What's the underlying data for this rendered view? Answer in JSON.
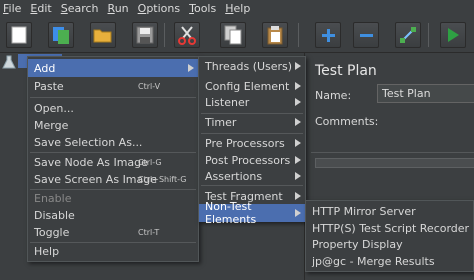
{
  "menubar": {
    "items": [
      {
        "label": "File"
      },
      {
        "label": "Edit"
      },
      {
        "label": "Search"
      },
      {
        "label": "Run"
      },
      {
        "label": "Options"
      },
      {
        "label": "Tools"
      },
      {
        "label": "Help"
      }
    ]
  },
  "toolbar": {
    "buttons": [
      {
        "icon": "new-file-icon"
      },
      {
        "icon": "templates-icon"
      },
      {
        "icon": "open-folder-icon"
      },
      {
        "icon": "save-icon"
      },
      {
        "icon": "cut-icon"
      },
      {
        "icon": "copy-icon"
      },
      {
        "icon": "paste-icon"
      },
      {
        "icon": "expand-plus-icon"
      },
      {
        "icon": "collapse-minus-icon"
      },
      {
        "icon": "toggle-icon"
      },
      {
        "icon": "run-icon"
      }
    ]
  },
  "tree": {
    "root_icon": "test-plan-flask-icon",
    "selected_label": ""
  },
  "context_menu": {
    "items": [
      {
        "label": "Add",
        "has_submenu": true
      },
      {
        "label": "Paste",
        "shortcut": "Ctrl-V"
      },
      {
        "label": "Open..."
      },
      {
        "label": "Merge"
      },
      {
        "label": "Save Selection As..."
      },
      {
        "label": "Save Node As Image",
        "shortcut": "Ctrl-G"
      },
      {
        "label": "Save Screen As Image",
        "shortcut": "Ctrl+Shift-G"
      },
      {
        "label": "Enable",
        "disabled": true
      },
      {
        "label": "Disable"
      },
      {
        "label": "Toggle",
        "shortcut": "Ctrl-T"
      },
      {
        "label": "Help"
      }
    ]
  },
  "add_submenu": {
    "items": [
      {
        "label": "Threads (Users)"
      },
      {
        "label": "Config Element"
      },
      {
        "label": "Listener"
      },
      {
        "label": "Timer"
      },
      {
        "label": "Pre Processors"
      },
      {
        "label": "Post Processors"
      },
      {
        "label": "Assertions"
      },
      {
        "label": "Test Fragment"
      },
      {
        "label": "Non-Test Elements"
      }
    ]
  },
  "non_test_submenu": {
    "items": [
      {
        "label": "HTTP Mirror Server"
      },
      {
        "label": "HTTP(S) Test Script Recorder"
      },
      {
        "label": "Property Display"
      },
      {
        "label": "jp@gc - Merge Results"
      }
    ]
  },
  "right_panel": {
    "title": "Test Plan",
    "name_label": "Name:",
    "name_value": "Test Plan",
    "comments_label": "Comments:"
  },
  "colors": {
    "background": "#3c3f41",
    "selection": "#4b6eaf",
    "text": "#d8d8d8",
    "disabled_text": "#888888"
  }
}
